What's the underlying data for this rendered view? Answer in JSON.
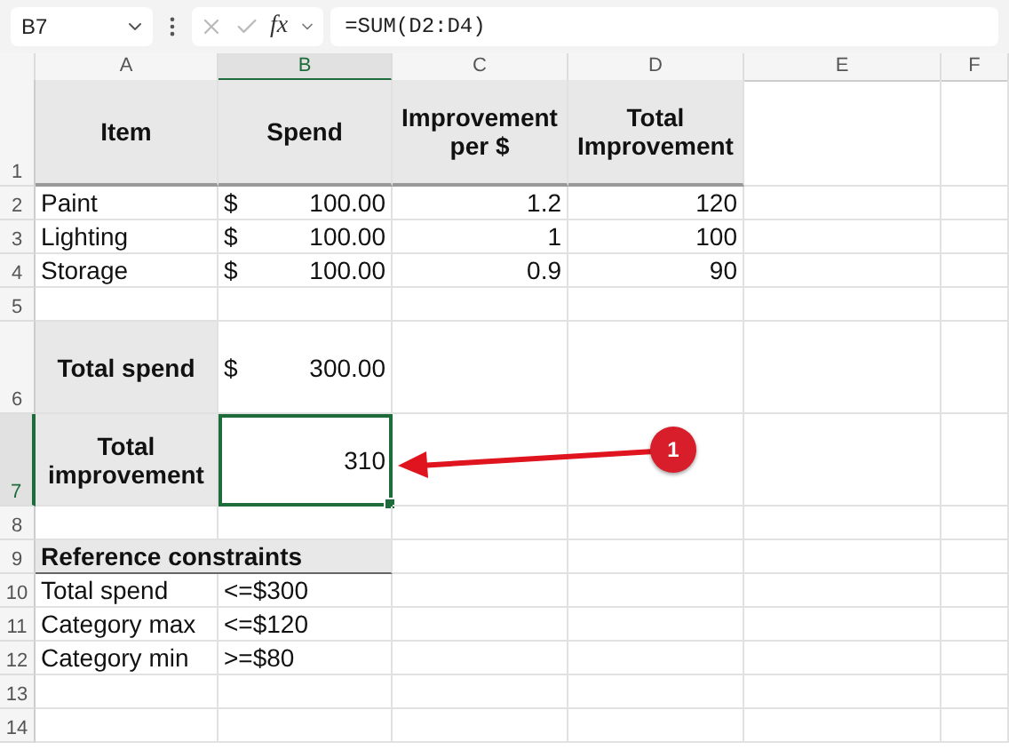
{
  "formula_bar": {
    "name_box": "B7",
    "function_label": "fx",
    "formula": "=SUM(D2:D4)"
  },
  "columns": [
    {
      "label": "A",
      "selected": false
    },
    {
      "label": "B",
      "selected": true
    },
    {
      "label": "C",
      "selected": false
    },
    {
      "label": "D",
      "selected": false
    },
    {
      "label": "E",
      "selected": false
    },
    {
      "label": "F",
      "selected": false
    }
  ],
  "rows": [
    {
      "label": "1",
      "selected": false,
      "kind": "heading",
      "cells": [
        {
          "kind": "heading",
          "text": "Item"
        },
        {
          "kind": "heading",
          "text": "Spend"
        },
        {
          "kind": "heading",
          "text": "Improvement per $"
        },
        {
          "kind": "heading",
          "text": "Total Improvement"
        },
        null,
        null
      ]
    },
    {
      "label": "2",
      "selected": false,
      "kind": "body",
      "cells": [
        {
          "kind": "text",
          "text": "Paint"
        },
        {
          "kind": "currency",
          "symbol": "$",
          "text": "100.00"
        },
        {
          "kind": "number",
          "text": "1.2"
        },
        {
          "kind": "number",
          "text": "120"
        },
        null,
        null
      ]
    },
    {
      "label": "3",
      "selected": false,
      "kind": "body",
      "cells": [
        {
          "kind": "text",
          "text": "Lighting"
        },
        {
          "kind": "currency",
          "symbol": "$",
          "text": "100.00"
        },
        {
          "kind": "number",
          "text": "1"
        },
        {
          "kind": "number",
          "text": "100"
        },
        null,
        null
      ]
    },
    {
      "label": "4",
      "selected": false,
      "kind": "body",
      "cells": [
        {
          "kind": "text",
          "text": "Storage"
        },
        {
          "kind": "currency",
          "symbol": "$",
          "text": "100.00"
        },
        {
          "kind": "number",
          "text": "0.9"
        },
        {
          "kind": "number",
          "text": "90"
        },
        null,
        null
      ]
    },
    {
      "label": "5",
      "selected": false,
      "kind": "body",
      "cells": [
        null,
        null,
        null,
        null,
        null,
        null
      ]
    },
    {
      "label": "6",
      "selected": false,
      "kind": "total",
      "cells": [
        {
          "kind": "heading",
          "text": "Total spend"
        },
        {
          "kind": "currency",
          "symbol": "$",
          "text": "300.00"
        },
        null,
        null,
        null,
        null
      ]
    },
    {
      "label": "7",
      "selected": true,
      "kind": "total",
      "cells": [
        {
          "kind": "heading",
          "text": "Total improvement"
        },
        {
          "kind": "number",
          "text": "310"
        },
        null,
        null,
        null,
        null
      ]
    },
    {
      "label": "8",
      "selected": false,
      "kind": "body",
      "cells": [
        null,
        null,
        null,
        null,
        null,
        null
      ]
    },
    {
      "label": "9",
      "selected": false,
      "kind": "body",
      "cells": [
        {
          "kind": "section",
          "text": "Reference constraints"
        },
        null,
        null,
        null,
        null,
        null
      ]
    },
    {
      "label": "10",
      "selected": false,
      "kind": "body",
      "cells": [
        {
          "kind": "text",
          "text": "Total spend"
        },
        {
          "kind": "text",
          "text": "<=$300"
        },
        null,
        null,
        null,
        null
      ]
    },
    {
      "label": "11",
      "selected": false,
      "kind": "body",
      "cells": [
        {
          "kind": "text",
          "text": "Category max"
        },
        {
          "kind": "text",
          "text": "<=$120"
        },
        null,
        null,
        null,
        null
      ]
    },
    {
      "label": "12",
      "selected": false,
      "kind": "body",
      "cells": [
        {
          "kind": "text",
          "text": "Category min"
        },
        {
          "kind": "text",
          "text": ">=$80"
        },
        null,
        null,
        null,
        null
      ]
    },
    {
      "label": "13",
      "selected": false,
      "kind": "body",
      "cells": [
        null,
        null,
        null,
        null,
        null,
        null
      ]
    },
    {
      "label": "14",
      "selected": false,
      "kind": "body",
      "cells": [
        null,
        null,
        null,
        null,
        null,
        null
      ]
    }
  ],
  "callout": {
    "label": "1"
  }
}
